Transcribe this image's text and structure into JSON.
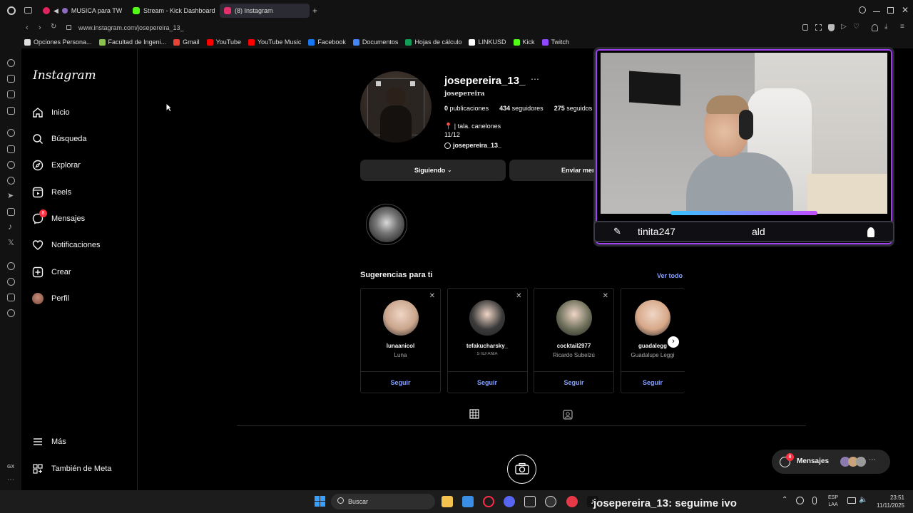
{
  "browser": {
    "tabs": [
      {
        "label": "MUSICA para TWI",
        "color": "#e0245e"
      },
      {
        "label": "Stream - Kick Dashboard",
        "color": "#53fc18"
      },
      {
        "label": "(8) Instagram",
        "color": "#e1306c"
      }
    ],
    "url": "www.instagram.com/josepereira_13_",
    "bookmarks": [
      {
        "label": "Opciones Persona...",
        "color": "#dddddd"
      },
      {
        "label": "Facultad de Ingeni...",
        "color": "#8bc34a"
      },
      {
        "label": "Gmail",
        "color": "#ea4335"
      },
      {
        "label": "YouTube",
        "color": "#ff0000"
      },
      {
        "label": "YouTube Music",
        "color": "#ff0000"
      },
      {
        "label": "Facebook",
        "color": "#1877f2"
      },
      {
        "label": "Documentos",
        "color": "#4285f4"
      },
      {
        "label": "Hojas de cálculo",
        "color": "#0f9d58"
      },
      {
        "label": "LINKUSD",
        "color": "#ffffff"
      },
      {
        "label": "Kick",
        "color": "#53fc18"
      },
      {
        "label": "Twitch",
        "color": "#9146ff"
      }
    ],
    "sidebar_label": "GX"
  },
  "instagram": {
    "logo": "Instagram",
    "nav": [
      {
        "label": "Inicio",
        "icon": "home-icon"
      },
      {
        "label": "Búsqueda",
        "icon": "search-icon"
      },
      {
        "label": "Explorar",
        "icon": "compass-icon"
      },
      {
        "label": "Reels",
        "icon": "reels-icon"
      },
      {
        "label": "Mensajes",
        "icon": "messenger-icon",
        "badge": "8"
      },
      {
        "label": "Notificaciones",
        "icon": "heart-icon"
      },
      {
        "label": "Crear",
        "icon": "plus-square-icon"
      },
      {
        "label": "Perfil",
        "icon": "avatar-icon"
      }
    ],
    "nav_bottom": [
      {
        "label": "Más",
        "icon": "menu-icon"
      },
      {
        "label": "También de Meta",
        "icon": "meta-icon"
      }
    ],
    "profile": {
      "username": "josepereira_13_",
      "name": "josepereira",
      "posts": "0",
      "posts_label": "publicaciones",
      "followers": "434",
      "followers_label": "seguidores",
      "following": "275",
      "following_label": "seguidos",
      "bio_line1": "| tala. canelones",
      "bio_line2": "11/12",
      "threads_handle": "josepereira_13_",
      "following_button": "Siguiendo",
      "message_button": "Enviar men"
    },
    "suggestions": {
      "title": "Sugerencias para ti",
      "see_all": "Ver todo",
      "follow_label": "Seguir",
      "items": [
        {
          "username": "lunaanicol",
          "name": "Luna",
          "color": "#c9a58c"
        },
        {
          "username": "tefakucharsky_",
          "name": "STEFANIA",
          "color": "#3a3a3a"
        },
        {
          "username": "cocktail2977",
          "name": "Ricardo Subelzú",
          "color": "#6d6f5a"
        },
        {
          "username": "guadalegg",
          "name": "Guadalupe Leggi",
          "color": "#d7a889"
        }
      ]
    },
    "messages_pill": {
      "label": "Mensajes",
      "badge": "8"
    }
  },
  "stream": {
    "chat_user": "tinita247",
    "chat_text": "ald",
    "bottom_ticker": "josepereira_13: seguime ivo"
  },
  "taskbar": {
    "search_placeholder": "Buscar",
    "lang": "ESP",
    "lang2": "LAA",
    "time": "23:51",
    "date": "11/11/2025"
  }
}
